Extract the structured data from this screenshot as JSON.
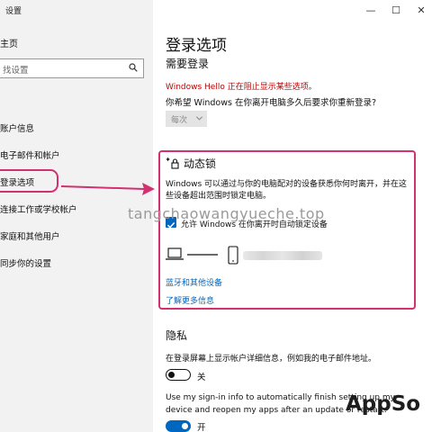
{
  "window": {
    "title": "设置",
    "controls": {
      "minimize": "—",
      "maximize": "☐",
      "close": "✕"
    }
  },
  "sidebar": {
    "home": "主页",
    "search_placeholder": "找设置",
    "items": [
      {
        "label": "账户信息"
      },
      {
        "label": "电子邮件和帐户"
      },
      {
        "label": "登录选项"
      },
      {
        "label": "连接工作或学校帐户"
      },
      {
        "label": "家庭和其他用户"
      },
      {
        "label": "同步你的设置"
      }
    ]
  },
  "main": {
    "page_title": "登录选项",
    "section_require": "需要登录",
    "hello_warning": "Windows Hello 正在阻止显示某些选项。",
    "question": "你希望 Windows 在你离开电脑多久后要求你重新登录?",
    "dropdown_value": "每次",
    "dynamic_lock": {
      "title": "动态锁",
      "description": "Windows 可以通过与你的电脑配对的设备获悉你何时离开，并在这些设备超出范围时锁定电脑。",
      "checkbox_label": "允许 Windows 在你离开时自动锁定设备",
      "link_bluetooth": "蓝牙和其他设备",
      "link_more": "了解更多信息"
    },
    "privacy": {
      "title": "隐私",
      "description": "在登录屏幕上显示帐户详细信息，例如我的电子邮件地址。",
      "toggle1_label": "关",
      "english_text": "Use my sign-in info to automatically finish setting up my device and reopen my apps after an update or restart.",
      "toggle2_label": "开"
    }
  },
  "overlay": {
    "watermark": "tangchaowangyueche.top",
    "brand": "AppSo"
  },
  "colors": {
    "accent": "#0067c0",
    "highlight": "#d2306e",
    "warning": "#c00000",
    "sidebar_bg": "#f2f2f2"
  }
}
